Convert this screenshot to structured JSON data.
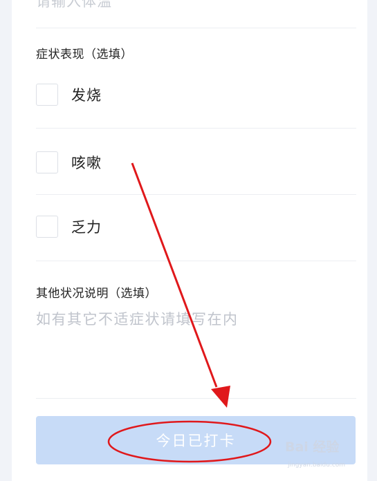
{
  "form": {
    "temperature_placeholder_cut": "请输入体温",
    "symptoms": {
      "label": "症状表现（选填）",
      "options": [
        {
          "label": "发烧",
          "checked": false
        },
        {
          "label": "咳嗽",
          "checked": false
        },
        {
          "label": "乏力",
          "checked": false
        }
      ]
    },
    "other": {
      "label": "其他状况说明（选填）",
      "placeholder": "如有其它不适症状请填写在内"
    },
    "submit": {
      "label": "今日已打卡",
      "state": "disabled"
    }
  },
  "annotation": {
    "arrow_color": "#e0181b",
    "ellipse_color": "#e0181b"
  },
  "watermark": {
    "brand": "Bai 经验",
    "sub": "jingyan.baidu.com"
  },
  "colors": {
    "button_bg": "#c7dbf7",
    "side_bg": "#f1f3f8",
    "placeholder": "#c0c4cc"
  }
}
